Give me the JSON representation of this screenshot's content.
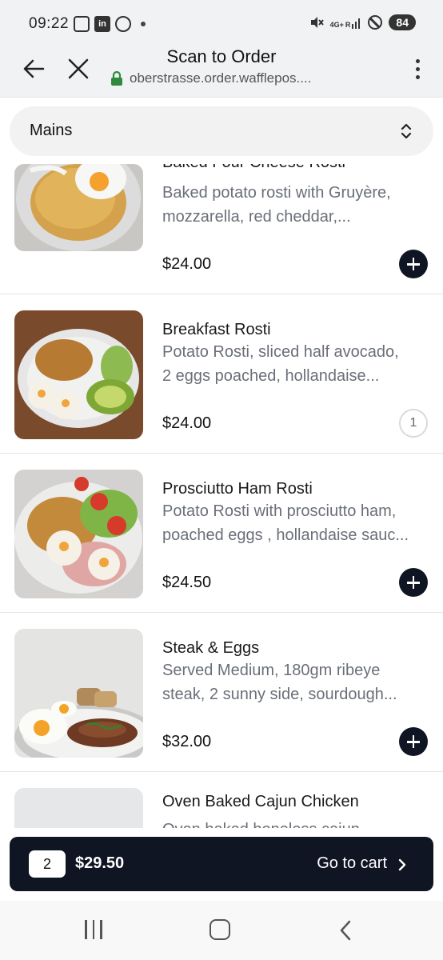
{
  "status_bar": {
    "time": "09:22",
    "network": "4G+",
    "network_r": "R",
    "battery": "84"
  },
  "browser": {
    "title": "Scan to Order",
    "url": "oberstrasse.order.wafflepos....",
    "icons": [
      "back-arrow-icon",
      "close-icon",
      "lock-icon",
      "kebab-menu-icon"
    ],
    "lock_color": "#2e8b3d"
  },
  "category": {
    "selected": "Mains"
  },
  "items": [
    {
      "name": "Baked Four Cheese Rosti",
      "desc_line1": "Baked potato rosti with Gruyère,",
      "desc_line2": "mozzarella, red cheddar,...",
      "price": "$24.00",
      "action": "add"
    },
    {
      "name": "Breakfast Rosti",
      "desc_line1": "Potato Rosti, sliced half avocado,",
      "desc_line2": "2 eggs poached, hollandaise...",
      "price": "$24.00",
      "action": "qty",
      "qty": "1"
    },
    {
      "name": "Prosciutto Ham Rosti",
      "desc_line1": "Potato Rosti with prosciutto ham,",
      "desc_line2": "poached eggs , hollandaise sauc...",
      "price": "$24.50",
      "action": "add"
    },
    {
      "name": "Steak & Eggs",
      "desc_line1": "Served Medium, 180gm ribeye",
      "desc_line2": "steak, 2 sunny side, sourdough...",
      "price": "$32.00",
      "action": "add"
    },
    {
      "name": "Oven Baked Cajun Chicken",
      "desc_line1": "Oven baked boneless cajun",
      "desc_line2": "",
      "price": "",
      "action": "none"
    }
  ],
  "cart": {
    "count": "2",
    "total": "$29.50",
    "label": "Go to cart"
  },
  "colors": {
    "accent_dark": "#0f1523",
    "muted_text": "#6a6f78",
    "chrome_bg": "#f1f2f4"
  }
}
